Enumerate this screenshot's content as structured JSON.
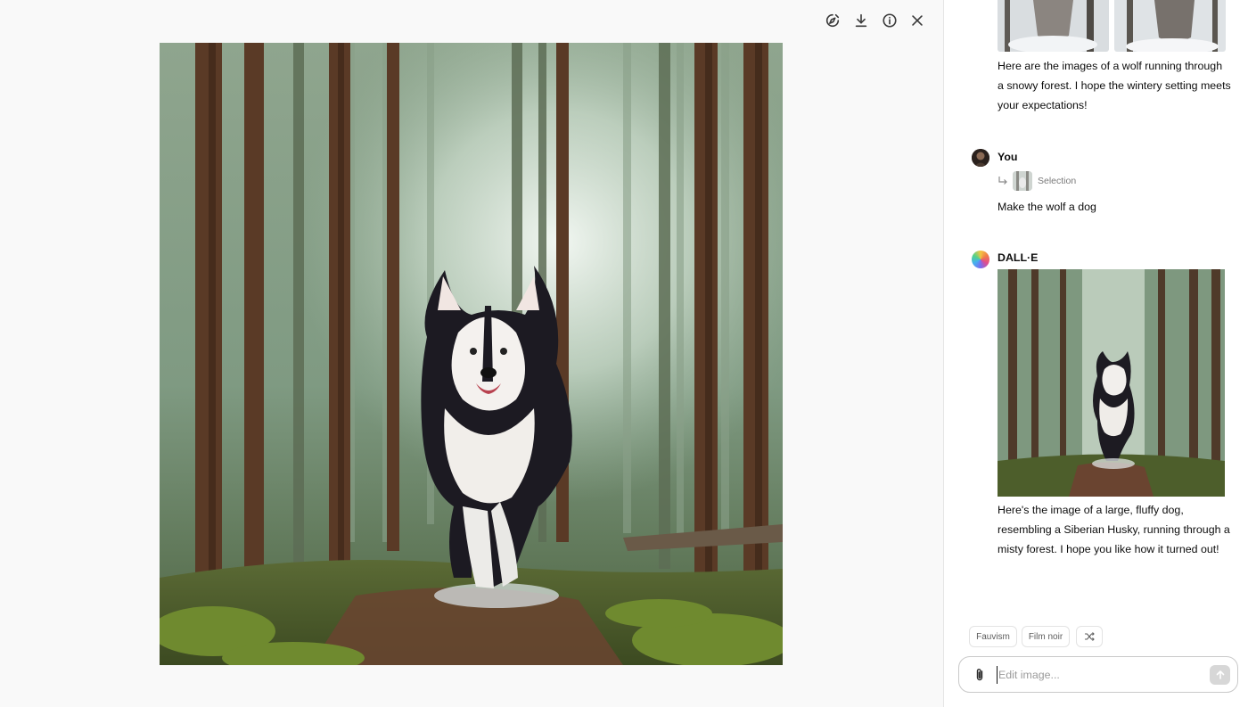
{
  "toolbar": {
    "icons": [
      "edit-selection-icon",
      "download-icon",
      "info-icon",
      "close-icon"
    ]
  },
  "conversation": {
    "first_reply": "Here are the images of a wolf running through a snowy forest. I hope the wintery setting meets your expectations!",
    "user": {
      "name": "You",
      "selection_label": "Selection",
      "message": "Make the wolf a dog"
    },
    "assistant": {
      "name": "DALL·E",
      "reply": "Here's the image of a large, fluffy dog, resembling a Siberian Husky, running through a misty forest. I hope you like how it turned out!"
    }
  },
  "style_chips": [
    "Fauvism",
    "Film noir"
  ],
  "composer": {
    "placeholder": "Edit image..."
  },
  "colors": {
    "panel_bg": "#f9f9f9",
    "send_button": "#d7d7d7"
  }
}
